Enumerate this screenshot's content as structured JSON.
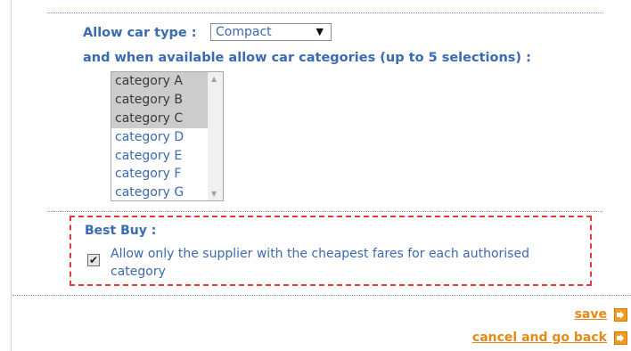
{
  "car_type": {
    "label": "Allow car type :",
    "selected": "Compact"
  },
  "categories": {
    "label": "and when available allow car categories (up to 5 selections) :",
    "items": [
      {
        "label": "category A",
        "selected": true
      },
      {
        "label": "category B",
        "selected": true
      },
      {
        "label": "category C",
        "selected": true
      },
      {
        "label": "category D",
        "selected": false
      },
      {
        "label": "category E",
        "selected": false
      },
      {
        "label": "category F",
        "selected": false
      },
      {
        "label": "category G",
        "selected": false
      }
    ]
  },
  "best_buy": {
    "title": "Best Buy :",
    "checkbox_label": "Allow only the supplier with the cheapest fares for each authorised category",
    "checked": true,
    "highlight_color": "#e23c3c"
  },
  "actions": {
    "save": "save",
    "cancel": "cancel and go back"
  },
  "colors": {
    "text_blue": "#3a6ab0",
    "link_orange": "#e58a17"
  }
}
